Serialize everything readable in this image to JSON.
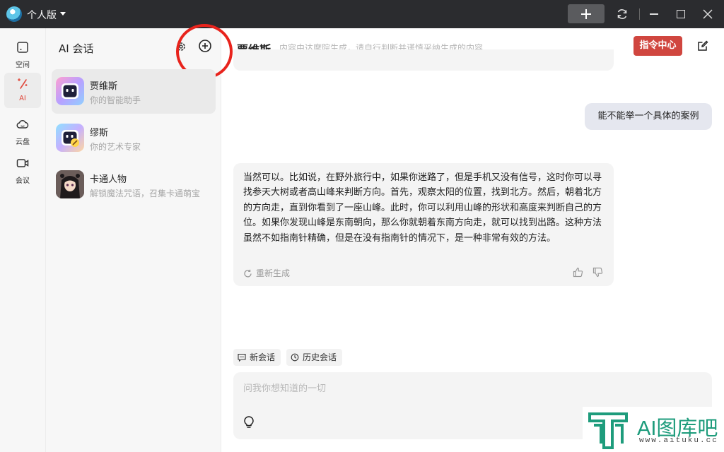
{
  "titlebar": {
    "title": "个人版"
  },
  "rail": {
    "items": [
      {
        "label": "空间",
        "icon": "space-icon"
      },
      {
        "label": "AI",
        "icon": "magic-wand-icon"
      },
      {
        "label": "云盘",
        "icon": "cloud-icon"
      },
      {
        "label": "会议",
        "icon": "video-icon"
      }
    ]
  },
  "sessions": {
    "title": "AI 会话",
    "items": [
      {
        "name": "贾维斯",
        "desc": "你的智能助手"
      },
      {
        "name": "缪斯",
        "desc": "你的艺术专家"
      },
      {
        "name": "卡通人物",
        "desc": "解锁魔法咒语，召集卡通萌宝"
      }
    ]
  },
  "chat": {
    "name": "贾维斯",
    "notice": "内容由达摩院生成，请自行判断并谨慎采纳生成的内容",
    "command_button": "指令中心",
    "user_message": "能不能举一个具体的案例",
    "ai_message": "当然可以。比如说，在野外旅行中，如果你迷路了，但是手机又没有信号，这时你可以寻找参天大树或者高山峰来判断方向。首先，观察太阳的位置，找到北方。然后，朝着北方的方向走，直到你看到了一座山峰。此时，你可以利用山峰的形状和高度来判断自己的方位。如果你发现山峰是东南朝向，那么你就朝着东南方向走，就可以找到出路。这种方法虽然不如指南针精确，但是在没有指南针的情况下，是一种非常有效的方法。",
    "regenerate": "重新生成",
    "new_chat": "新会话",
    "history": "历史会话",
    "input_placeholder": "问我你想知道的一切"
  },
  "watermark": {
    "text": "AI图库吧",
    "url": "www.aituku.cc"
  },
  "colors": {
    "accent": "#e0473a",
    "command_button": "#d0463f",
    "titlebar": "#2b2c2f",
    "annotation_circle": "#e8231c",
    "watermark": "#1e9c7c"
  }
}
